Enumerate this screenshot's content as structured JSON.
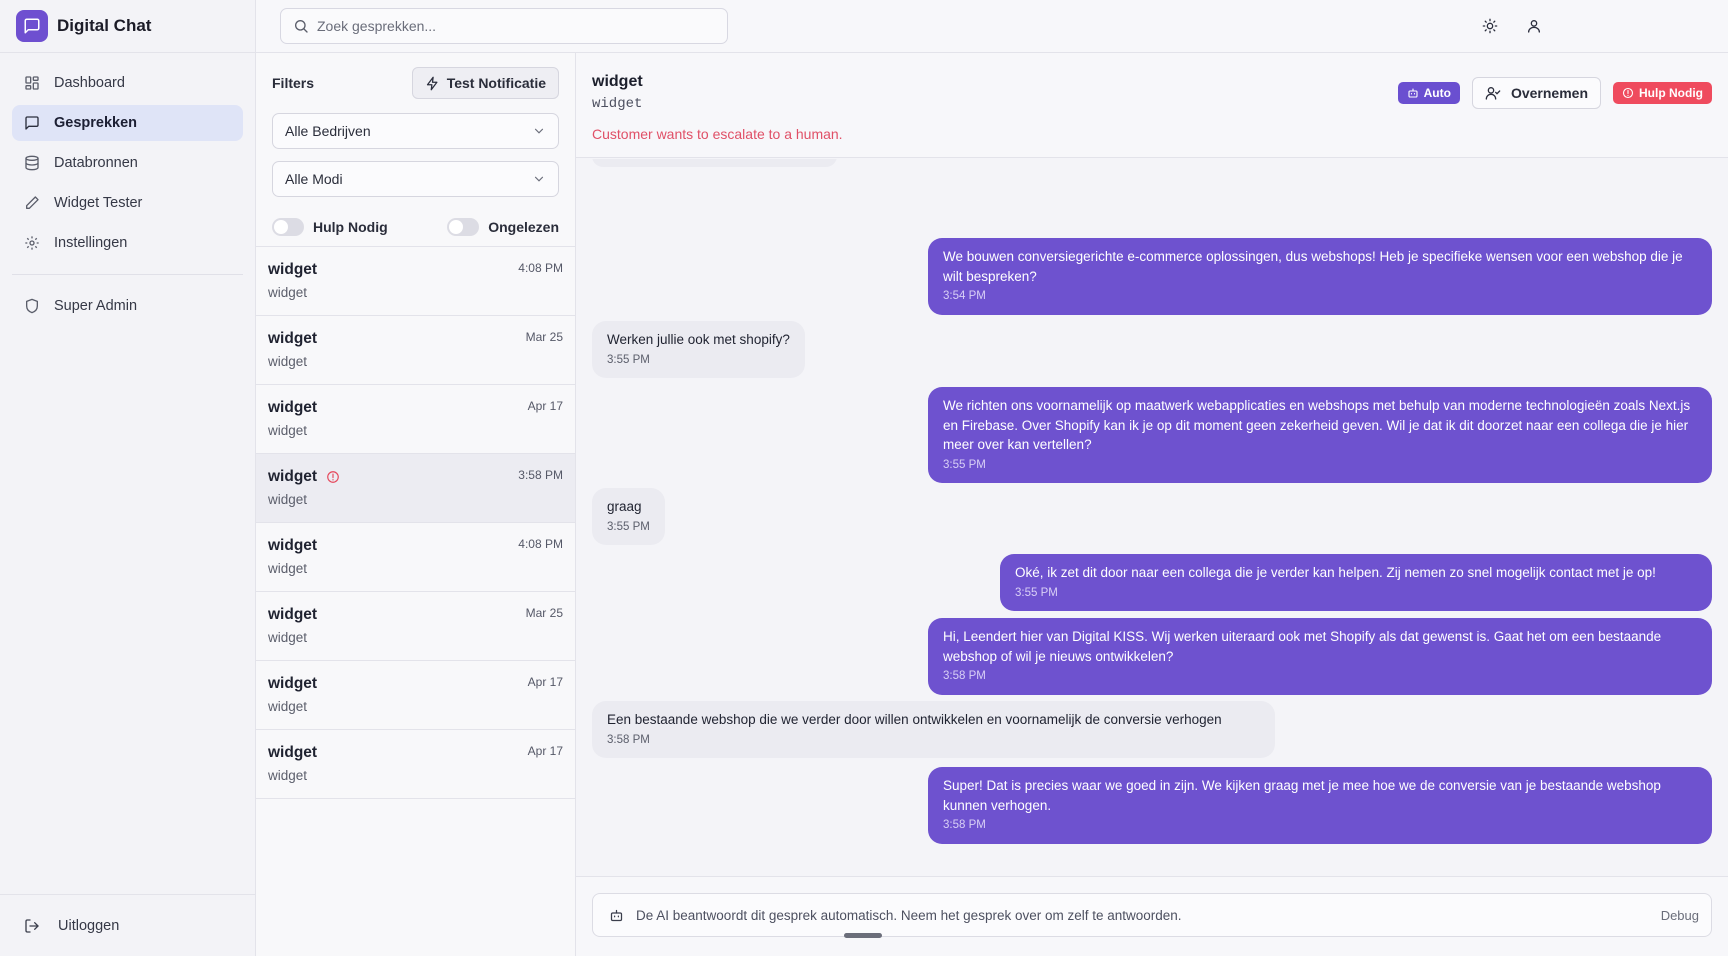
{
  "app": {
    "title": "Digital Chat"
  },
  "sidebar": {
    "items": [
      {
        "label": "Dashboard",
        "icon": "grid-icon",
        "active": false
      },
      {
        "label": "Gesprekken",
        "icon": "chat-icon",
        "active": true
      },
      {
        "label": "Databronnen",
        "icon": "database-icon",
        "active": false
      },
      {
        "label": "Widget Tester",
        "icon": "pencil-icon",
        "active": false
      },
      {
        "label": "Instellingen",
        "icon": "gear-icon",
        "active": false
      }
    ],
    "admin_label": "Super Admin",
    "logout_label": "Uitloggen"
  },
  "topbar": {
    "search_placeholder": "Zoek gesprekken..."
  },
  "filters": {
    "title": "Filters",
    "test_button": "Test Notificatie",
    "company_select": "Alle Bedrijven",
    "mode_select": "Alle Modi",
    "toggle_help": "Hulp Nodig",
    "toggle_unread": "Ongelezen"
  },
  "conversations": [
    {
      "title": "widget",
      "subtitle": "widget",
      "time": "4:08 PM",
      "alert": false,
      "selected": false
    },
    {
      "title": "widget",
      "subtitle": "widget",
      "time": "Mar 25",
      "alert": false,
      "selected": false
    },
    {
      "title": "widget",
      "subtitle": "widget",
      "time": "Apr 17",
      "alert": false,
      "selected": false
    },
    {
      "title": "widget",
      "subtitle": "widget",
      "time": "3:58 PM",
      "alert": true,
      "selected": true
    },
    {
      "title": "widget",
      "subtitle": "widget",
      "time": "4:08 PM",
      "alert": false,
      "selected": false
    },
    {
      "title": "widget",
      "subtitle": "widget",
      "time": "Mar 25",
      "alert": false,
      "selected": false
    },
    {
      "title": "widget",
      "subtitle": "widget",
      "time": "Apr 17",
      "alert": false,
      "selected": false
    },
    {
      "title": "widget",
      "subtitle": "widget",
      "time": "Apr 17",
      "alert": false,
      "selected": false
    }
  ],
  "chat": {
    "title": "widget",
    "subtitle": "widget",
    "escalation": "Customer wants to escalate to a human.",
    "badge_auto": "Auto",
    "take_over": "Overnemen",
    "badge_help": "Hulp Nodig",
    "messages": [
      {
        "dir": "out",
        "text": "We bouwen conversiegerichte e-commerce oplossingen, dus webshops! Heb je specifieke wensen voor een webshop die je wilt bespreken?",
        "time": "3:54 PM"
      },
      {
        "dir": "in",
        "text": "Werken jullie ook met shopify?",
        "time": "3:55 PM"
      },
      {
        "dir": "out",
        "text": "We richten ons voornamelijk op maatwerk webapplicaties en webshops met behulp van moderne technologieën zoals Next.js en Firebase. Over Shopify kan ik je op dit moment geen zekerheid geven. Wil je dat ik dit doorzet naar een collega die je hier meer over kan vertellen?",
        "time": "3:55 PM"
      },
      {
        "dir": "in",
        "text": "graag",
        "time": "3:55 PM"
      },
      {
        "dir": "out",
        "text": "Oké, ik zet dit door naar een collega die je verder kan helpen. Zij nemen zo snel mogelijk contact met je op!",
        "time": "3:55 PM"
      },
      {
        "dir": "out",
        "text": "Hi, Leendert hier van Digital KISS. Wij werken uiteraard ook met Shopify als dat gewenst is. Gaat het om een bestaande webshop of wil je nieuws ontwikkelen?",
        "time": "3:58 PM"
      },
      {
        "dir": "in",
        "text": "Een bestaande webshop die we verder door willen ontwikkelen en voornamelijk de conversie verhogen",
        "time": "3:58 PM"
      },
      {
        "dir": "out",
        "text": "Super! Dat is precies waar we goed in zijn. We kijken graag met je mee hoe we de conversie van je bestaande webshop kunnen verhogen.",
        "time": "3:58 PM"
      }
    ],
    "composer_notice": "De AI beantwoordt dit gesprek automatisch. Neem het gesprek over om zelf te antwoorden.",
    "debug_label": "Debug"
  },
  "colors": {
    "accent": "#6e52cf",
    "alert": "#ef4b5e",
    "escalation_text": "#e05067"
  }
}
